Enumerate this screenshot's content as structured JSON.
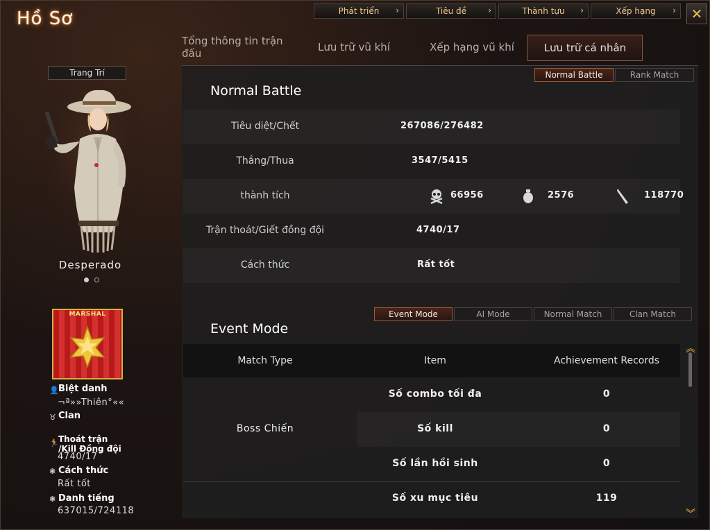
{
  "window": {
    "title": "Hồ Sơ",
    "close_icon": "✕"
  },
  "topnav": [
    {
      "label": "Phát triển"
    },
    {
      "label": "Tiêu đề"
    },
    {
      "label": "Thành tựu"
    },
    {
      "label": "Xếp hạng"
    }
  ],
  "tabs": [
    {
      "label": "Tổng thông tin trận đấu"
    },
    {
      "label": "Lưu trữ vũ khí"
    },
    {
      "label": "Xếp hạng vũ khí"
    },
    {
      "label": "Lưu trữ cá nhân",
      "active": true
    }
  ],
  "character": {
    "decorate_button": "Trang Trí",
    "name": "Desperado",
    "rank_label": "MARSHAL",
    "nickname_label": "Biệt danh",
    "nickname": "¬ª»»Thiên°««",
    "clan_label": "Clan",
    "escape_label_1": "Thoát trận",
    "escape_label_2": "/Kill Đồng đội",
    "escape_value": "4740/17",
    "style_label": "Cách thức",
    "style_value": "Rất tốt",
    "fame_label": "Danh tiếng",
    "fame_value": "637015/724118"
  },
  "mode_tabs": [
    {
      "label": "Normal Battle",
      "active": true
    },
    {
      "label": "Rank Match"
    }
  ],
  "normal_battle": {
    "title": "Normal Battle",
    "kd_label": "Tiêu diệt/Chết",
    "kd_value": "267086/276482",
    "wl_label": "Thắng/Thua",
    "wl_value": "3547/5415",
    "achievement_label": "thành tích",
    "headshot_value": "66956",
    "grenade_value": "2576",
    "knife_value": "118770",
    "escape_label": "Trận thoát/Giết đồng đội",
    "escape_value": "4740/17",
    "style_label": "Cách thức",
    "style_value": "Rất tốt"
  },
  "event_tabs": [
    {
      "label": "Event Mode",
      "active": true
    },
    {
      "label": "AI Mode"
    },
    {
      "label": "Normal Match"
    },
    {
      "label": "Clan Match"
    }
  ],
  "event_mode": {
    "title": "Event Mode",
    "headers": [
      "Match Type",
      "Item",
      "Achievement Records"
    ],
    "match_type": "Boss Chiến",
    "rows": [
      {
        "item": "Số combo tối đa",
        "value": "0"
      },
      {
        "item": "Số kill",
        "value": "0"
      },
      {
        "item": "Số lần hồi sinh",
        "value": "0"
      },
      {
        "item": "Số xu mục tiêu",
        "value": "119"
      }
    ]
  },
  "colors": {
    "accent": "#f0c890",
    "active_tab": "#9a5a3a",
    "close": "#f2c04a"
  }
}
